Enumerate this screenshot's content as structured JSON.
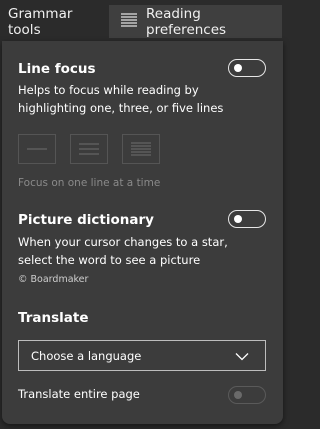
{
  "tabs": {
    "grammar_label": "Grammar tools",
    "reading_label": "Reading preferences"
  },
  "line_focus": {
    "title": "Line focus",
    "description_line1": "Helps to focus while reading by",
    "description_line2": "highlighting one, three, or five lines",
    "hint": "Focus on one line at a time",
    "enabled": false
  },
  "picture_dictionary": {
    "title": "Picture dictionary",
    "description_line1": "When your cursor changes to a star,",
    "description_line2": "select the word to see a picture",
    "credit": "© Boardmaker",
    "enabled": false
  },
  "translate": {
    "title": "Translate",
    "select_value": "Choose a language",
    "entire_page_label": "Translate entire page",
    "entire_page_enabled": false
  },
  "icons": [
    "lines-icon",
    "one-line-icon",
    "three-lines-icon",
    "five-lines-icon",
    "chevron-down-icon"
  ],
  "colors": {
    "background": "#2b2b2b",
    "panel": "#3c3c3c",
    "active_tab": "#3f3f3f",
    "muted_text": "#8a8a8a"
  }
}
